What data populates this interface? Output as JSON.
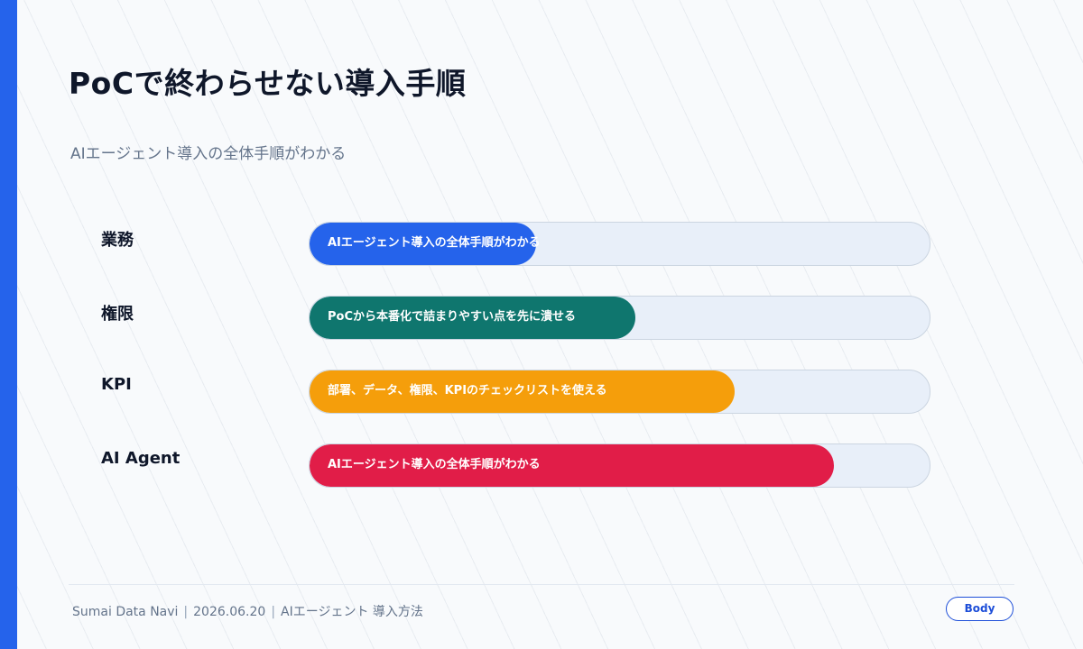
{
  "slide": {
    "title": "PoCで終わらせない導入手順",
    "subtitle": "AIエージェント導入の全体手順がわかる"
  },
  "rows": [
    {
      "label": "業務",
      "bar_text": "AIエージェント導入の全体手順がわかる",
      "progress": 0.365,
      "color": "#2563eb"
    },
    {
      "label": "権限",
      "bar_text": "PoCから本番化で詰まりやすい点を先に潰せる",
      "progress": 0.525,
      "color": "#0f766e"
    },
    {
      "label": "KPI",
      "bar_text": "部署、データ、権限、KPIのチェックリストを使える",
      "progress": 0.685,
      "color": "#f59e0b"
    },
    {
      "label": "AI Agent",
      "bar_text": "AIエージェント導入の全体手順がわかる",
      "progress": 0.845,
      "color": "#e11d48"
    }
  ],
  "footer": {
    "brand": "Sumai Data Navi",
    "date": "2026.06.20",
    "topic": "AIエージェント 導入方法",
    "tag": "Body"
  },
  "colors": {
    "accent": "#2563eb",
    "track": "#e8eff9"
  }
}
